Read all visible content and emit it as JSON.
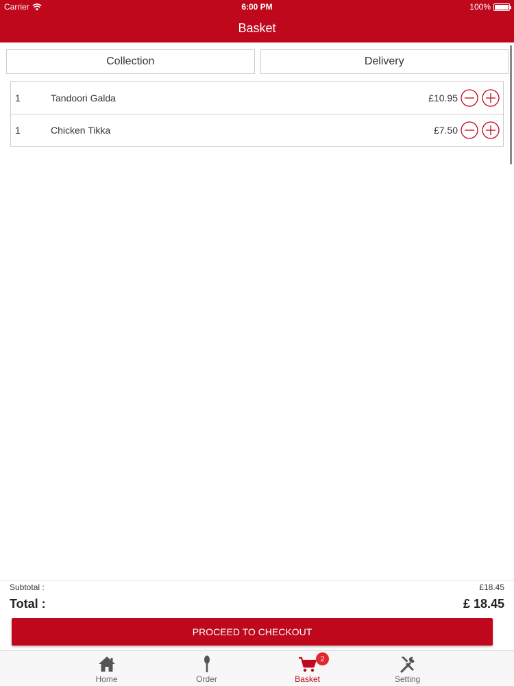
{
  "status_bar": {
    "carrier": "Carrier",
    "time": "6:00 PM",
    "battery": "100%"
  },
  "nav": {
    "title": "Basket"
  },
  "order_type_tabs": [
    {
      "label": "Collection"
    },
    {
      "label": "Delivery"
    }
  ],
  "basket_items": [
    {
      "qty": "1",
      "name": "Tandoori Galda",
      "price": "£10.95"
    },
    {
      "qty": "1",
      "name": "Chicken Tikka",
      "price": "£7.50"
    }
  ],
  "summary": {
    "subtotal_label": "Subtotal :",
    "subtotal_value": "£18.45",
    "total_label": "Total :",
    "total_value": "£ 18.45"
  },
  "checkout": {
    "label": "PROCEED TO CHECKOUT"
  },
  "tab_bar": {
    "items": [
      {
        "label": "Home",
        "icon": "home-icon"
      },
      {
        "label": "Order",
        "icon": "spoon-icon"
      },
      {
        "label": "Basket",
        "icon": "cart-icon",
        "badge": "2"
      },
      {
        "label": "Setting",
        "icon": "tools-icon"
      }
    ]
  },
  "colors": {
    "brand": "#c0081c",
    "badge": "#e3252f"
  }
}
